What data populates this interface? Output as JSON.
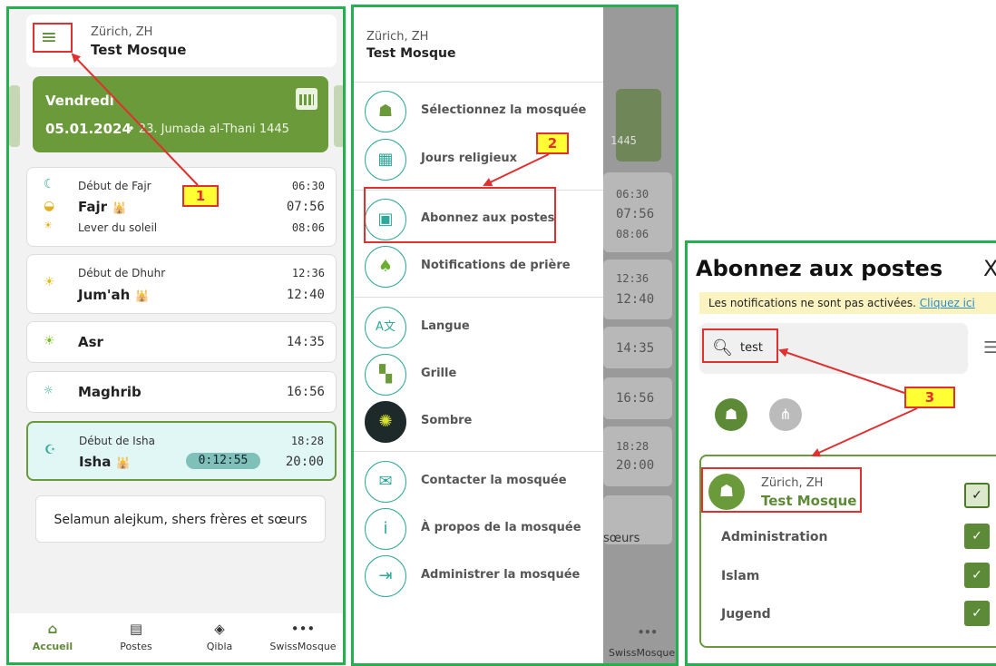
{
  "panel1": {
    "header": {
      "city": "Zürich, ZH",
      "mosque": "Test Mosque",
      "menu_icon": "≡"
    },
    "day": {
      "name": "Vendredi",
      "date": "05.01.2024",
      "hijri": "• 23. Jumada al-Thani 1445"
    },
    "prayers": [
      {
        "start_label": "Début de Fajr",
        "start_time": "06:30",
        "name": "Fajr",
        "time": "07:56",
        "sun_label": "Lever du soleil",
        "sun_time": "08:06"
      },
      {
        "start_label": "Début de Dhuhr",
        "start_time": "12:36",
        "name": "Jum'ah",
        "time": "12:40"
      },
      {
        "name": "Asr",
        "time": "14:35"
      },
      {
        "name": "Maghrib",
        "time": "16:56"
      },
      {
        "start_label": "Début de Isha",
        "start_time": "18:28",
        "name": "Isha",
        "time": "20:00",
        "countdown": "0:12:55"
      }
    ],
    "greeting": "Selamun alejkum, shers frères et sœurs",
    "tabs": [
      {
        "label": "Accueil",
        "icon": "home-icon"
      },
      {
        "label": "Postes",
        "icon": "document-icon"
      },
      {
        "label": "Qibla",
        "icon": "compass-icon"
      },
      {
        "label": "SwissMosque",
        "icon": "more-icon"
      }
    ]
  },
  "panel2": {
    "header": {
      "city": "Zürich, ZH",
      "mosque": "Test Mosque"
    },
    "menu": [
      {
        "label": "Sélectionnez la mosquée",
        "icon": "mosque-icon"
      },
      {
        "label": "Jours religieux",
        "icon": "calendar-icon"
      },
      {
        "label": "Abonnez aux postes",
        "icon": "subscribe-icon"
      },
      {
        "label": "Notifications de prière",
        "icon": "bell-icon"
      },
      {
        "label": "Langue",
        "icon": "language-icon"
      },
      {
        "label": "Grille",
        "icon": "grid-icon"
      },
      {
        "label": "Sombre",
        "icon": "bulb-icon"
      },
      {
        "label": "Contacter la mosquée",
        "icon": "mail-icon"
      },
      {
        "label": "À propos de la mosquée",
        "icon": "info-icon"
      },
      {
        "label": "Administrer la mosquée",
        "icon": "login-icon"
      }
    ],
    "bg": {
      "hijri": "1445",
      "times": [
        "06:30",
        "07:56",
        "08:06",
        "12:36",
        "12:40",
        "14:35",
        "16:56",
        "18:28",
        "20:00"
      ],
      "greeting_tail": "sœurs",
      "tab_label": "SwissMosque"
    }
  },
  "panel3": {
    "title": "Abonnez aux postes",
    "close": "X",
    "notice": "Les notifications ne sont pas activées.",
    "notice_link": "Cliquez ici",
    "search_value": "test",
    "result": {
      "city": "Zürich, ZH",
      "mosque": "Test Mosque"
    },
    "categories": [
      "Administration",
      "Islam",
      "Jugend"
    ]
  },
  "annotations": {
    "n1": "1",
    "n2": "2",
    "n3": "3"
  },
  "colors": {
    "frame": "#22b14c",
    "brand": "#6a9a3a",
    "teal": "#2fa89a",
    "annotation": "#e03030"
  }
}
